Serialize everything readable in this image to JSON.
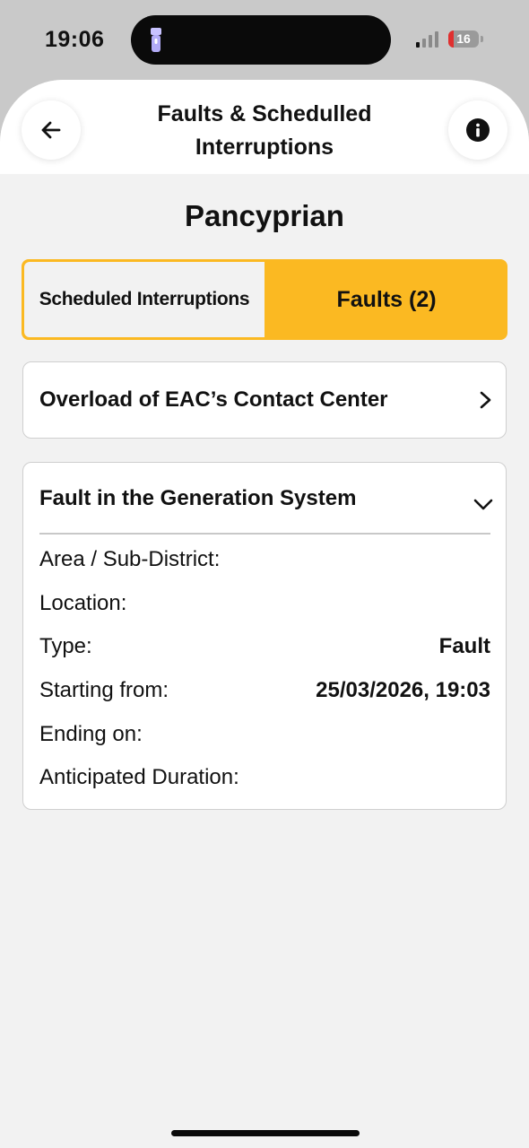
{
  "status_bar": {
    "time": "19:06",
    "battery_level": "16",
    "colors": {
      "battery_low": "#e0302f"
    }
  },
  "header": {
    "title_line1": "Faults & Schedulled",
    "title_line2": "Interruptions",
    "back_icon": "arrow-left-icon",
    "info_icon": "info-icon"
  },
  "region": "Pancyprian",
  "tabs": {
    "scheduled_label": "Scheduled Interruptions",
    "faults_label": "Faults  (2)",
    "active": "faults",
    "accent_color": "#fbb922"
  },
  "faults": [
    {
      "title": "Overload of EAC’s Contact Center",
      "expanded": false,
      "icon": "chevron-right-icon"
    },
    {
      "title": "Fault in the Generation System",
      "expanded": true,
      "icon": "chevron-down-icon",
      "details": [
        {
          "label": "Area / Sub-District:",
          "value": ""
        },
        {
          "label": "Location:",
          "value": ""
        },
        {
          "label": "Type:",
          "value": "Fault"
        },
        {
          "label": "Starting from:",
          "value": "25/03/2026, 19:03"
        },
        {
          "label": "Ending on:",
          "value": ""
        },
        {
          "label": "Anticipated Duration:",
          "value": ""
        }
      ]
    }
  ]
}
